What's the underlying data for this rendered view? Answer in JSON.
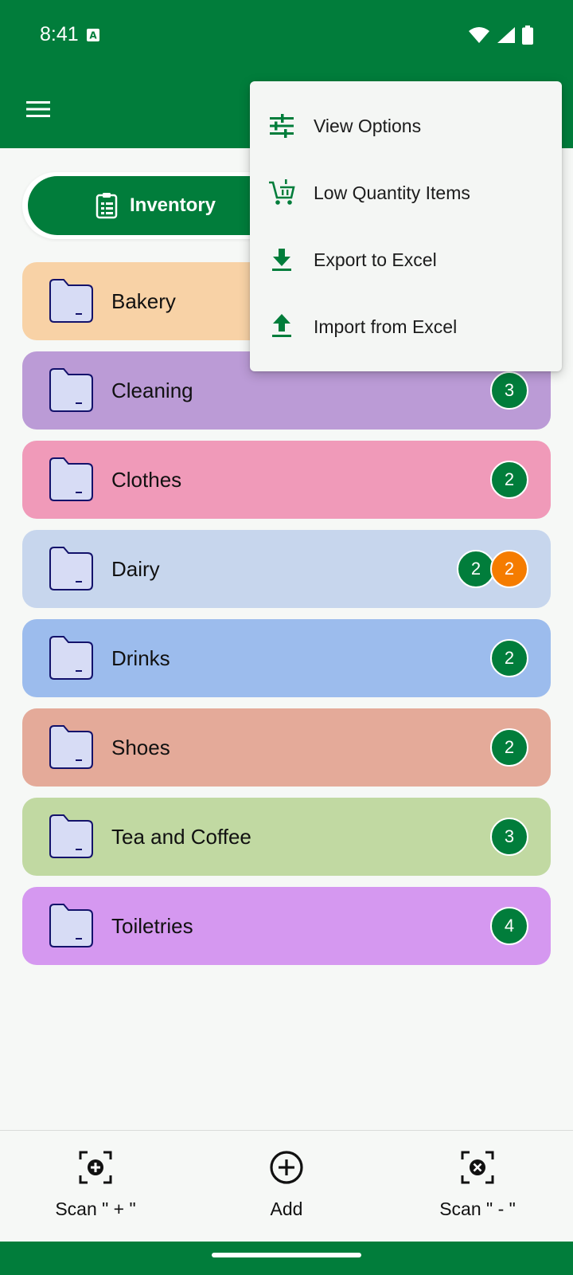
{
  "status": {
    "time": "8:41"
  },
  "tabs": {
    "inventory_label": "Inventory"
  },
  "categories": [
    {
      "name": "Bakery",
      "color": "#f8d2a6",
      "badges": []
    },
    {
      "name": "Cleaning",
      "color": "#bb9bd6",
      "badges": [
        {
          "value": "3",
          "color": "#017d3b"
        }
      ]
    },
    {
      "name": "Clothes",
      "color": "#f09ab9",
      "badges": [
        {
          "value": "2",
          "color": "#017d3b"
        }
      ]
    },
    {
      "name": "Dairy",
      "color": "#c7d6ed",
      "badges": [
        {
          "value": "2",
          "color": "#017d3b"
        },
        {
          "value": "2",
          "color": "#f57c00"
        }
      ]
    },
    {
      "name": "Drinks",
      "color": "#9cbced",
      "badges": [
        {
          "value": "2",
          "color": "#017d3b"
        }
      ]
    },
    {
      "name": "Shoes",
      "color": "#e4aa99",
      "badges": [
        {
          "value": "2",
          "color": "#017d3b"
        }
      ]
    },
    {
      "name": "Tea and Coffee",
      "color": "#c1d9a2",
      "badges": [
        {
          "value": "3",
          "color": "#017d3b"
        }
      ]
    },
    {
      "name": "Toiletries",
      "color": "#d598f0",
      "badges": [
        {
          "value": "4",
          "color": "#017d3b"
        }
      ]
    }
  ],
  "menu": {
    "items": [
      {
        "label": "View Options",
        "icon": "tune-icon"
      },
      {
        "label": "Low Quantity Items",
        "icon": "cart-icon"
      },
      {
        "label": "Export to Excel",
        "icon": "download-icon"
      },
      {
        "label": "Import from Excel",
        "icon": "upload-icon"
      }
    ]
  },
  "bottom_nav": {
    "scan_plus": "Scan \" + \"",
    "add": "Add",
    "scan_minus": "Scan \" - \""
  },
  "colors": {
    "primary": "#017d3b",
    "badge_alert": "#f57c00"
  }
}
